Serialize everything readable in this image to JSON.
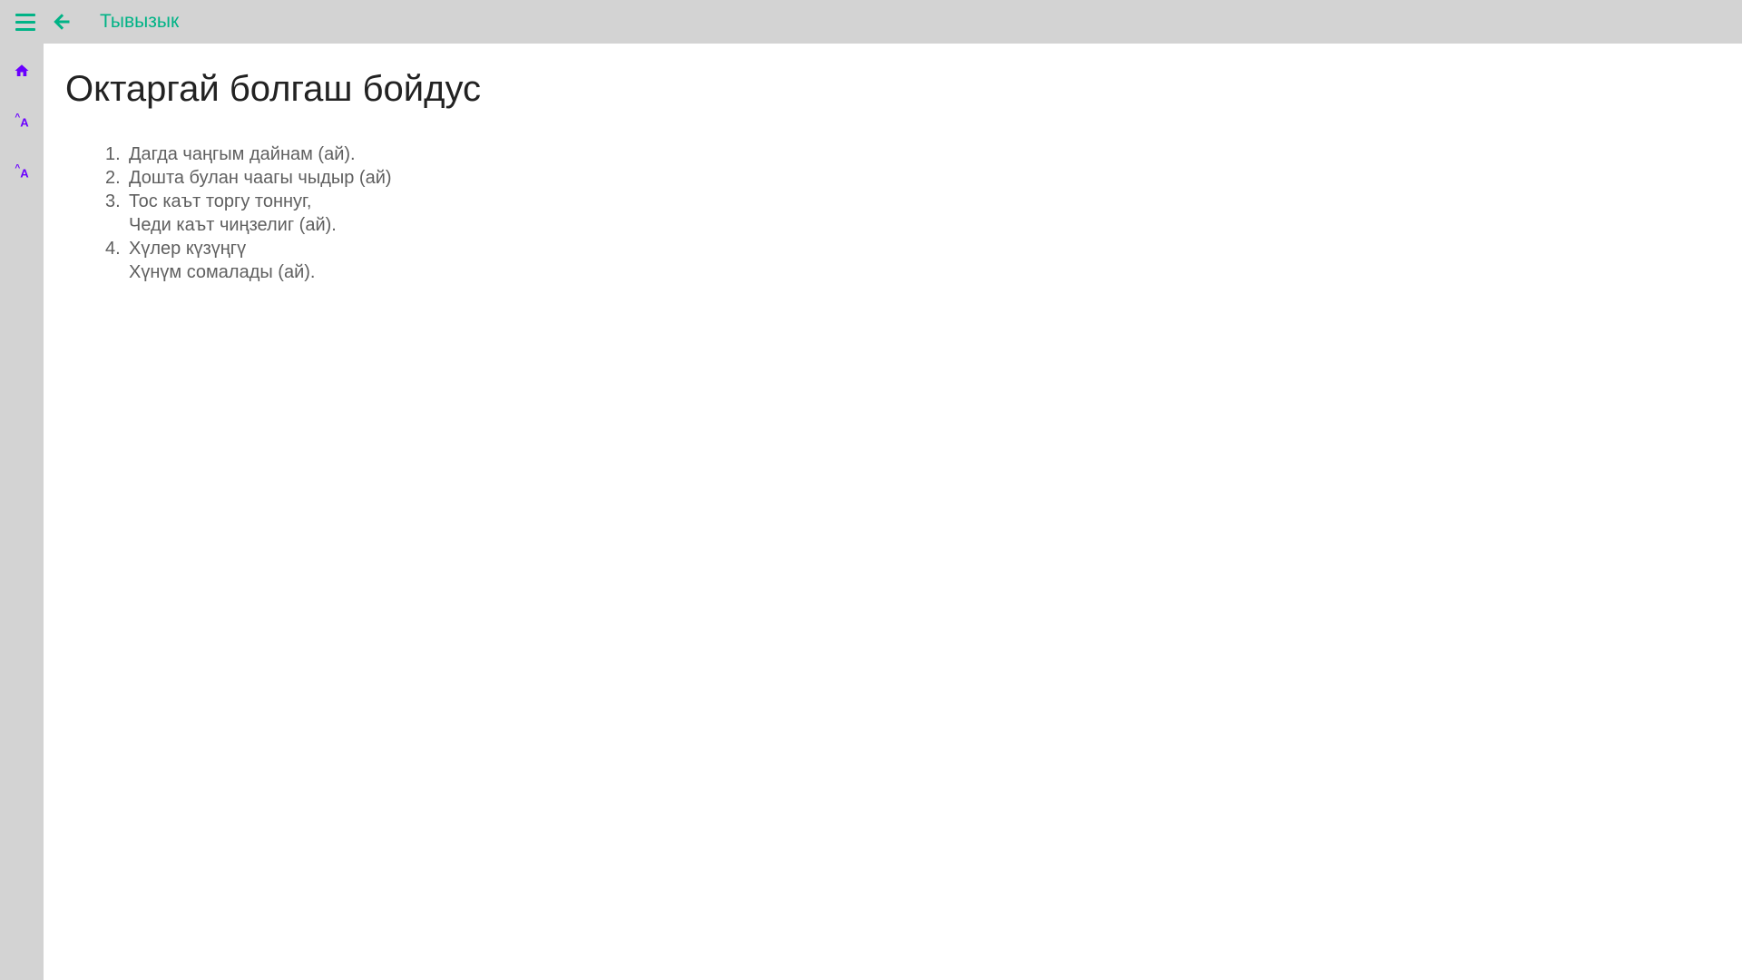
{
  "topbar": {
    "title": "Тывызык"
  },
  "sidebar": {
    "home_label": "home",
    "font_increase_label": "^A",
    "font_decrease_label": "^A"
  },
  "content": {
    "title": "Октаргай болгаш бойдус",
    "riddles": [
      "Дагда чаңгым дайнам (ай).",
      "Дошта булан чаагы чыдыр (ай)",
      "Тос каът торгу тоннуг,\nЧеди каът чиңзелиг (ай).",
      "Хүлер күзүңгү\nХүнүм сомалады (ай)."
    ]
  }
}
